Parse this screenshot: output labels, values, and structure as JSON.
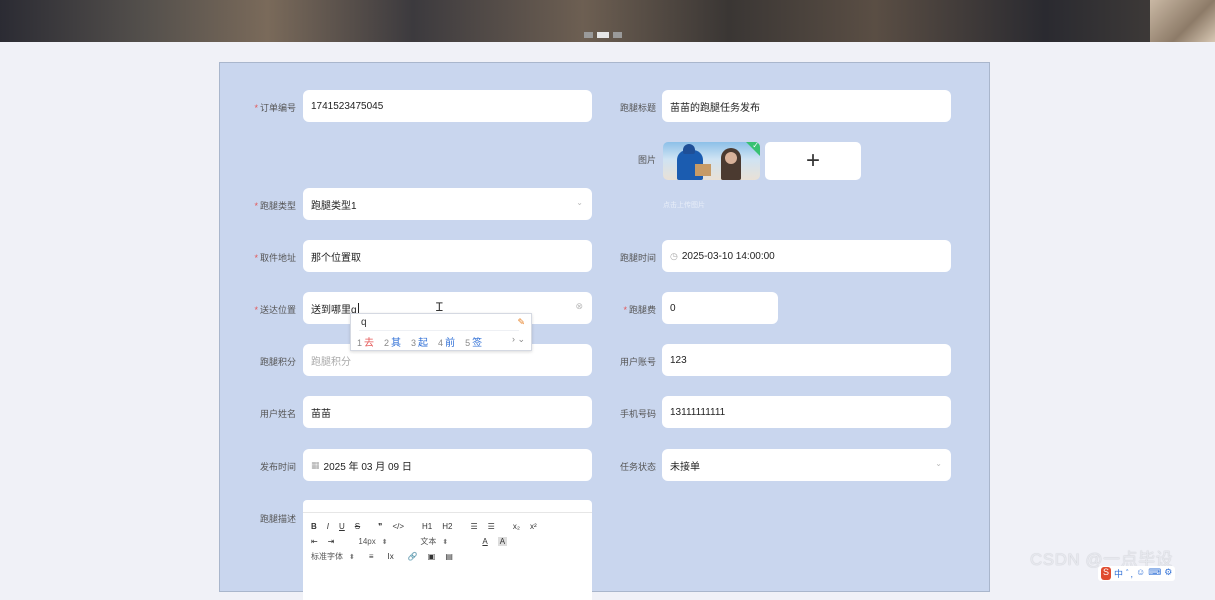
{
  "form": {
    "order_no": {
      "label": "订单编号",
      "value": "1741523475045"
    },
    "errand_title": {
      "label": "跑腿标题",
      "value": "苗苗的跑腿任务发布"
    },
    "image": {
      "label": "图片",
      "hint": "点击上传图片"
    },
    "errand_type": {
      "label": "跑腿类型",
      "value": "跑腿类型1"
    },
    "pickup_address": {
      "label": "取件地址",
      "value": "那个位置取"
    },
    "errand_time": {
      "label": "跑腿时间",
      "value": "2025-03-10 14:00:00"
    },
    "delivery_location": {
      "label": "送达位置",
      "value": "送到哪里q"
    },
    "errand_fee": {
      "label": "跑腿费",
      "value": "0"
    },
    "errand_points": {
      "label": "跑腿积分",
      "placeholder": "跑腿积分"
    },
    "user_account": {
      "label": "用户账号",
      "value": "123"
    },
    "user_name": {
      "label": "用户姓名",
      "value": "苗苗"
    },
    "phone": {
      "label": "手机号码",
      "value": "13111111111"
    },
    "publish_time": {
      "label": "发布时间",
      "value": "2025 年 03 月 09 日"
    },
    "task_status": {
      "label": "任务状态",
      "value": "未接单"
    },
    "description": {
      "label": "跑腿描述",
      "toolbar": {
        "row1": [
          "B",
          "I",
          "U",
          "S",
          "❞",
          "</>",
          "H1",
          "H2",
          "☰",
          "☰",
          "x₂",
          "x²"
        ],
        "font_size": "14px",
        "text_type": "文本",
        "font_family": "标准字体"
      }
    }
  },
  "ime": {
    "composition": "q",
    "candidates": [
      {
        "n": "1",
        "text": "去"
      },
      {
        "n": "2",
        "text": "其"
      },
      {
        "n": "3",
        "text": "起"
      },
      {
        "n": "4",
        "text": "前"
      },
      {
        "n": "5",
        "text": "签"
      }
    ],
    "more": "› ⌄"
  },
  "watermark": "CSDN @一点毕设",
  "ime_status": {
    "logo": "S",
    "items": [
      "中",
      "ﾞ,",
      "☺",
      "⌨",
      "⚙",
      "⋯"
    ]
  }
}
